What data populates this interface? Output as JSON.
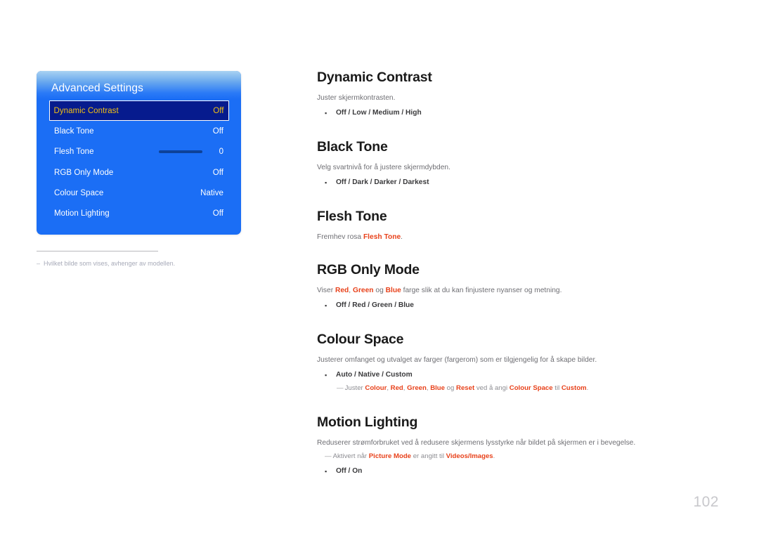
{
  "osd": {
    "title": "Advanced Settings",
    "rows": [
      {
        "label": "Dynamic Contrast",
        "value": "Off",
        "selected": true,
        "type": "value"
      },
      {
        "label": "Black Tone",
        "value": "Off",
        "selected": false,
        "type": "value"
      },
      {
        "label": "Flesh Tone",
        "value": "0",
        "selected": false,
        "type": "slider"
      },
      {
        "label": "RGB Only Mode",
        "value": "Off",
        "selected": false,
        "type": "value"
      },
      {
        "label": "Colour Space",
        "value": "Native",
        "selected": false,
        "type": "value"
      },
      {
        "label": "Motion Lighting",
        "value": "Off",
        "selected": false,
        "type": "value"
      }
    ],
    "colors": {
      "panel_blue": "#1b6ef5",
      "selected_row": "#061b8e",
      "selected_text": "#f2c014",
      "slider_bar": "#0e4298"
    }
  },
  "left_note": {
    "dash": "–",
    "text": "Hvilket bilde som vises, avhenger av modellen."
  },
  "sections": {
    "dynamic_contrast": {
      "title": "Dynamic Contrast",
      "desc": "Juster skjermkontrasten.",
      "options_label": "Off / Low / Medium / High"
    },
    "black_tone": {
      "title": "Black Tone",
      "desc": "Velg svartnivå for å justere skjermdybden.",
      "options_label": "Off / Dark / Darker / Darkest"
    },
    "flesh_tone": {
      "title": "Flesh Tone",
      "desc_pre": "Fremhev rosa ",
      "desc_kw": "Flesh Tone",
      "desc_post": "."
    },
    "rgb_only_mode": {
      "title": "RGB Only Mode",
      "desc_pre": "Viser ",
      "desc_kw1": "Red",
      "desc_mid1": ", ",
      "desc_kw2": "Green",
      "desc_mid2": " og ",
      "desc_kw3": "Blue",
      "desc_post": " farge slik at du kan finjustere nyanser og metning.",
      "options_label": "Off / Red / Green / Blue"
    },
    "colour_space": {
      "title": "Colour Space",
      "desc": "Justerer omfanget og utvalget av farger (fargerom) som er tilgjengelig for å skape bilder.",
      "options_label": "Auto / Native / Custom",
      "note": {
        "dash": "―",
        "t0": "Juster ",
        "k1": "Colour",
        "t1": ", ",
        "k2": "Red",
        "t2": ", ",
        "k3": "Green",
        "t3": ", ",
        "k4": "Blue",
        "t4": " og ",
        "k5": "Reset",
        "t5": " ved å angi ",
        "k6": "Colour Space",
        "t6": " til ",
        "k7": "Custom",
        "t7": "."
      }
    },
    "motion_lighting": {
      "title": "Motion Lighting",
      "desc": "Reduserer strømforbruket ved å redusere skjermens lysstyrke når bildet på skjermen er i bevegelse.",
      "note": {
        "dash": "―",
        "t0": "Aktivert når ",
        "k1": "Picture Mode",
        "t1": " er angitt til ",
        "k2": "Videos/Images",
        "t2": "."
      },
      "options_label": "Off / On"
    }
  },
  "page_number": "102"
}
